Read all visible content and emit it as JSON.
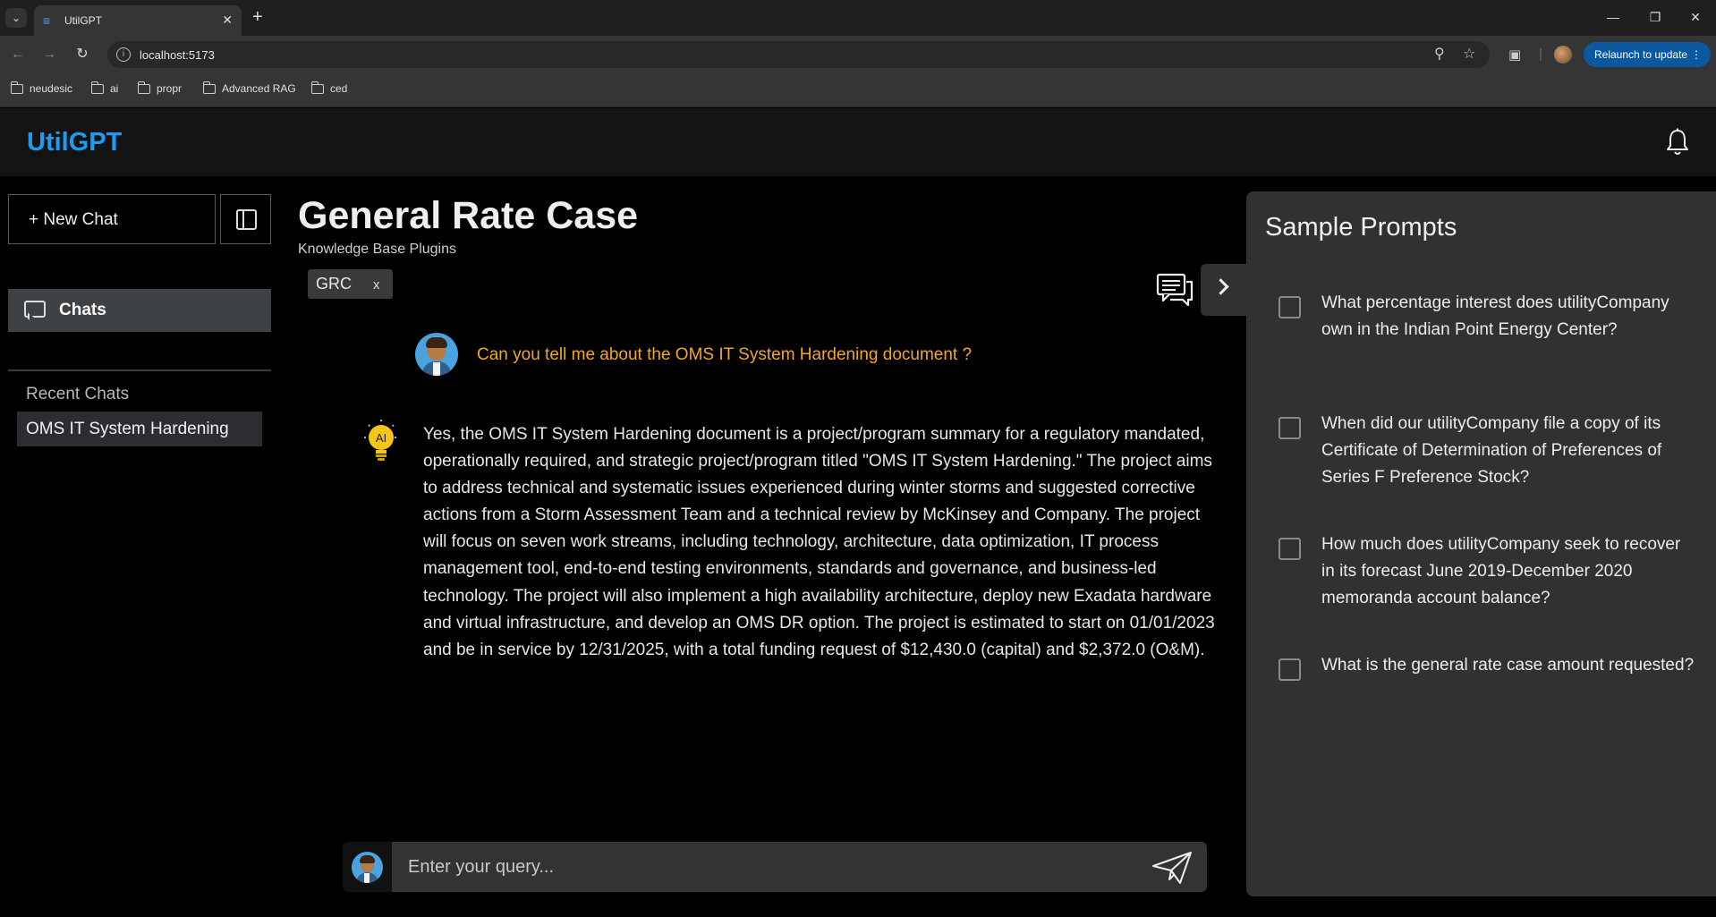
{
  "browser": {
    "tab_title": "UtilGPT",
    "url": "localhost:5173",
    "relaunch_label": "Relaunch to update",
    "bookmarks": [
      "neudesic",
      "ai",
      "propr",
      "Advanced RAG",
      "ced"
    ]
  },
  "app": {
    "brand": "UtilGPT",
    "accent_color": "#1e9bf0"
  },
  "sidebar": {
    "new_chat_label": "+ New Chat",
    "chats_label": "Chats",
    "recent_heading": "Recent Chats",
    "recent_items": [
      "OMS IT System Hardening"
    ]
  },
  "main": {
    "title": "General Rate Case",
    "subtitle": "Knowledge Base Plugins",
    "plugin_chip": {
      "label": "GRC",
      "remove": "x"
    },
    "user_question": "Can you tell me about the OMS IT System Hardening document ?",
    "ai_badge": "AI",
    "ai_answer": "Yes, the OMS IT System Hardening document is a project/program summary for a regulatory mandated, operationally required, and strategic project/program titled \"OMS IT System Hardening.\" The project aims to address technical and systematic issues experienced during winter storms and suggested corrective actions from a Storm Assessment Team and a technical review by McKinsey and Company. The project will focus on seven work streams, including technology, architecture, data optimization, IT process management tool, end-to-end testing environments, standards and governance, and business-led technology. The project will also implement a high availability architecture, deploy new Exadata hardware and virtual infrastructure, and develop an OMS DR option. The project is estimated to start on 01/01/2023 and be in service by 12/31/2025, with a total funding request of $12,430.0 (capital) and $2,372.0 (O&M).",
    "query_placeholder": "Enter your query...",
    "question_color": "#f5a623"
  },
  "prompts": {
    "title": "Sample Prompts",
    "items": [
      "What percentage interest does utilityCompany own in the Indian Point Energy Center?",
      "When did our utilityCompany file a copy of its Certificate of Determination of Preferences of Series F Preference Stock?",
      "How much does utilityCompany seek to recover in its forecast June 2019-December 2020 memoranda account balance?",
      "What is the general rate case amount requested?"
    ]
  }
}
